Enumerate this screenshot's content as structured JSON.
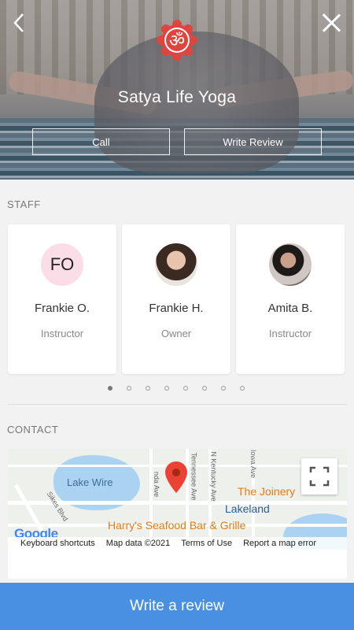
{
  "header": {
    "title": "Satya Life Yoga",
    "call_label": "Call",
    "write_review_label": "Write Review",
    "back_icon": "chevron-left-icon",
    "close_icon": "close-icon",
    "logo_glyph": "ॐ"
  },
  "staff": {
    "section_label": "STAFF",
    "members": [
      {
        "initials": "FO",
        "name": "Frankie O.",
        "role": "Instructor"
      },
      {
        "name": "Frankie H.",
        "role": "Owner"
      },
      {
        "name": "Amita B.",
        "role": "Instructor"
      }
    ],
    "pagination": {
      "pages": 8,
      "active": 0
    }
  },
  "contact": {
    "section_label": "CONTACT",
    "map": {
      "lake_label": "Lake Wire",
      "street_labels": [
        "Sikes Blvd",
        "nda Ave",
        "Tennessee Ave",
        "N Kentucky Ave",
        "Iowa Ave"
      ],
      "poi_labels": [
        "The Joinery",
        "Lakeland",
        "Harry's Seafood Bar & Grille"
      ],
      "google_label": "Google",
      "footer": [
        "Keyboard shortcuts",
        "Map data ©2021",
        "Terms of Use",
        "Report a map error"
      ]
    }
  },
  "bottom": {
    "write_review_label": "Write a review"
  },
  "colors": {
    "accent": "#4a90e2",
    "logo_red": "#e0443e"
  }
}
